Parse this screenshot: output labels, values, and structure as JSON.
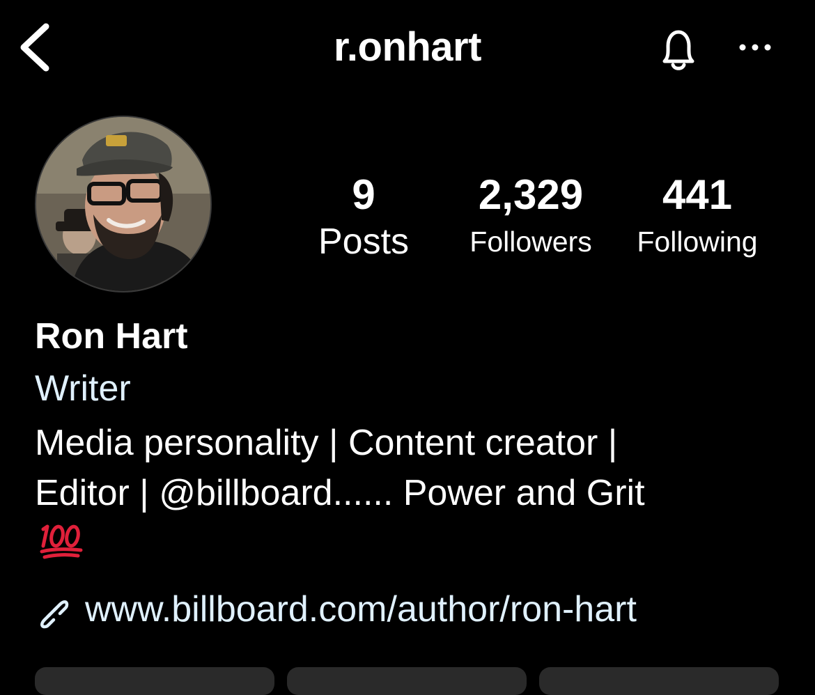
{
  "header": {
    "username": "r.onhart",
    "back_icon": "chevron-left-icon",
    "notifications_icon": "bell-icon",
    "more_icon": "ellipsis-icon"
  },
  "profile": {
    "avatar_alt": "avatar",
    "stats": {
      "posts": {
        "count": "9",
        "label": "Posts"
      },
      "followers": {
        "count": "2,329",
        "label": "Followers"
      },
      "following": {
        "count": "441",
        "label": "Following"
      }
    },
    "full_name": "Ron Hart",
    "category": "Writer",
    "bio_lines": [
      "Media personality | Content creator |",
      "Editor | @billboard...... Power and Grit"
    ],
    "bio_emoji": "hundred-points-emoji",
    "link": {
      "icon": "link-icon",
      "text": "www.billboard.com/author/ron-hart"
    }
  },
  "colors": {
    "background": "#000000",
    "text": "#ffffff",
    "link": "#e0f1ff",
    "emoji_red": "#e0203a",
    "button_bg": "#2a2a2a"
  }
}
